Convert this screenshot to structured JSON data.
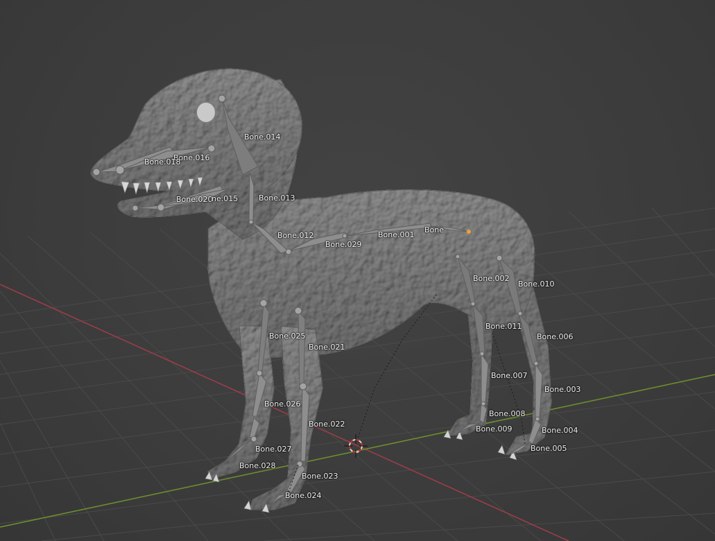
{
  "viewport": {
    "background_color": "#3d3d3d",
    "grid_color": "#4b4b4b",
    "x_axis_color": "#a3404f",
    "y_axis_color": "#6a8f2d",
    "mesh_color": "#a9a9a9",
    "bone_color": "#8f8f8f",
    "selected_origin_color": "#f0a030",
    "cursor_icon": "3d-cursor-icon"
  },
  "bones": [
    {
      "id": "bone-014",
      "label": "Bone.014"
    },
    {
      "id": "bone-016",
      "label": "Bone.016"
    },
    {
      "id": "bone-018",
      "label": "Bone.018"
    },
    {
      "id": "bone-020",
      "label": "Bone.020"
    },
    {
      "id": "bone-015",
      "label": "ne.015"
    },
    {
      "id": "bone-013",
      "label": "Bone.013"
    },
    {
      "id": "bone-012",
      "label": "Bone.012"
    },
    {
      "id": "bone-029",
      "label": "Bone.029"
    },
    {
      "id": "bone-001",
      "label": "Bone.001"
    },
    {
      "id": "bone",
      "label": "Bone"
    },
    {
      "id": "bone-002",
      "label": "Bone.002"
    },
    {
      "id": "bone-010",
      "label": "Bone.010"
    },
    {
      "id": "bone-011",
      "label": "Bone.011"
    },
    {
      "id": "bone-006",
      "label": "Bone.006"
    },
    {
      "id": "bone-007",
      "label": "Bone.007"
    },
    {
      "id": "bone-003",
      "label": "Bone.003"
    },
    {
      "id": "bone-008",
      "label": "Bone.008"
    },
    {
      "id": "bone-009",
      "label": "Bone.009"
    },
    {
      "id": "bone-004",
      "label": "Bone.004"
    },
    {
      "id": "bone-005",
      "label": "Bone.005"
    },
    {
      "id": "bone-025",
      "label": "Bone.025"
    },
    {
      "id": "bone-021",
      "label": "Bone.021"
    },
    {
      "id": "bone-026",
      "label": "Bone.026"
    },
    {
      "id": "bone-022",
      "label": "Bone.022"
    },
    {
      "id": "bone-027",
      "label": "Bone.027"
    },
    {
      "id": "bone-028",
      "label": "Bone.028"
    },
    {
      "id": "bone-023",
      "label": "Bone.023"
    },
    {
      "id": "bone-024",
      "label": "Bone.024"
    }
  ]
}
